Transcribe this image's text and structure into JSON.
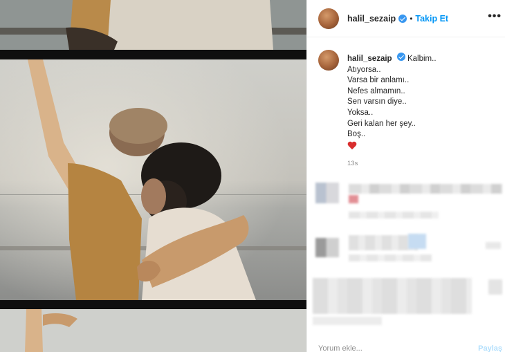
{
  "post": {
    "username": "halil_sezaip",
    "follow_label": "Takip Et",
    "separator": "•",
    "more_label": "•••",
    "caption": {
      "username": "halil_sezaip",
      "lines": [
        "Kalbim..",
        "Atıyorsa..",
        "Varsa bir anlamı..",
        "Nefes almamın..",
        "Sen varsın diye..",
        "Yoksa..",
        "Geri kalan her şey..",
        "Boş.."
      ],
      "emoji": "red-heart"
    },
    "time_ago": "13s"
  },
  "comment_box": {
    "placeholder": "Yorum ekle...",
    "post_label": "Paylaş"
  },
  "colors": {
    "accent": "#0095f6",
    "verified": "#3897f0",
    "heart": "#d92e2e",
    "muted": "#8e8e8e"
  }
}
